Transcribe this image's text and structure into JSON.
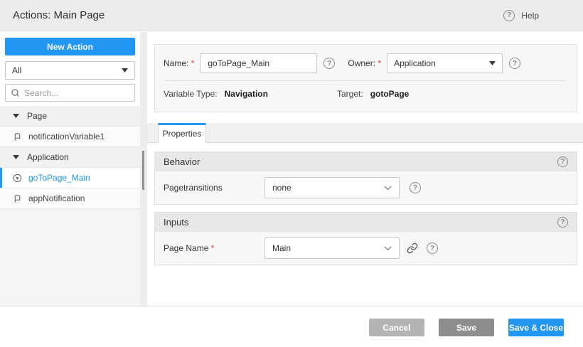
{
  "header": {
    "title": "Actions: Main Page",
    "help_label": "Help",
    "help_glyph": "?"
  },
  "sidebar": {
    "new_action_label": "New Action",
    "filter_value": "All",
    "search_placeholder": "Search...",
    "tree": [
      {
        "type": "group",
        "label": "Page"
      },
      {
        "type": "item",
        "label": "notificationVariable1",
        "icon": "notification-variable-icon",
        "selected": false
      },
      {
        "type": "group",
        "label": "Application"
      },
      {
        "type": "item",
        "label": "goToPage_Main",
        "icon": "goto-page-icon",
        "selected": true
      },
      {
        "type": "item",
        "label": "appNotification",
        "icon": "notification-variable-icon",
        "selected": false
      }
    ]
  },
  "form": {
    "name_label": "Name:",
    "name_value": "goToPage_Main",
    "owner_label": "Owner:",
    "owner_value": "Application",
    "variable_type_label": "Variable Type:",
    "variable_type_value": "Navigation",
    "target_label": "Target:",
    "target_value": "gotoPage"
  },
  "tabs": [
    {
      "label": "Properties",
      "active": true
    }
  ],
  "sections": [
    {
      "title": "Behavior",
      "row_label": "Pagetransitions",
      "row_value": "none"
    },
    {
      "title": "Inputs",
      "row_label": "Page Name",
      "row_value": "Main"
    }
  ],
  "footer": {
    "buttons": [
      {
        "label": "Cancel"
      },
      {
        "label": "Save"
      },
      {
        "label": "Save & Close"
      }
    ]
  },
  "colors": {
    "accent": "#2196f3",
    "required_asterisk": "#e53935",
    "cancel_button": "#b4b4b4",
    "save_button": "#8d8d8d"
  }
}
